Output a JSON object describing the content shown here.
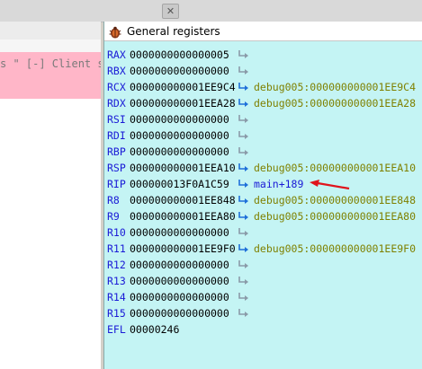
{
  "left_pane": {
    "snippet": "s \" [-] Client so"
  },
  "registers_panel": {
    "title": "General registers",
    "rows": [
      {
        "name": "RAX",
        "value": "0000000000000005",
        "target": ""
      },
      {
        "name": "RBX",
        "value": "0000000000000000",
        "target": ""
      },
      {
        "name": "RCX",
        "value": "000000000001EE9C4",
        "target": "debug005:000000000001EE9C4"
      },
      {
        "name": "RDX",
        "value": "000000000001EEA28",
        "target": "debug005:000000000001EEA28"
      },
      {
        "name": "RSI",
        "value": "0000000000000000",
        "target": ""
      },
      {
        "name": "RDI",
        "value": "0000000000000000",
        "target": ""
      },
      {
        "name": "RBP",
        "value": "0000000000000000",
        "target": ""
      },
      {
        "name": "RSP",
        "value": "000000000001EEA10",
        "target": "debug005:000000000001EEA10"
      },
      {
        "name": "RIP",
        "value": "000000013F0A1C59",
        "target": "main+189"
      },
      {
        "name": "R8",
        "value": "000000000001EE848",
        "target": "debug005:000000000001EE848"
      },
      {
        "name": "R9",
        "value": "000000000001EEA80",
        "target": "debug005:000000000001EEA80"
      },
      {
        "name": "R10",
        "value": "0000000000000000",
        "target": ""
      },
      {
        "name": "R11",
        "value": "000000000001EE9F0",
        "target": "debug005:000000000001EE9F0"
      },
      {
        "name": "R12",
        "value": "0000000000000000",
        "target": ""
      },
      {
        "name": "R13",
        "value": "0000000000000000",
        "target": ""
      },
      {
        "name": "R14",
        "value": "0000000000000000",
        "target": ""
      },
      {
        "name": "R15",
        "value": "0000000000000000",
        "target": ""
      },
      {
        "name": "EFL",
        "value": "00000246",
        "target": ""
      }
    ]
  }
}
